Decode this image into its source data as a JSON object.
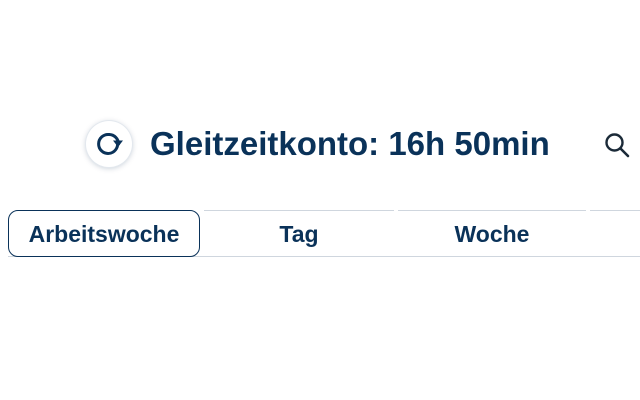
{
  "header": {
    "title": "Gleitzeitkonto: 16h 50min",
    "refresh_icon": "refresh-icon",
    "search_icon": "search-icon"
  },
  "tabs": [
    {
      "label": "Arbeitswoche",
      "active": true
    },
    {
      "label": "Tag",
      "active": false
    },
    {
      "label": "Woche",
      "active": false
    },
    {
      "label": "",
      "active": false
    }
  ],
  "colors": {
    "primary_text": "#0a3259",
    "divider": "#cfd6de",
    "background": "#ffffff"
  }
}
